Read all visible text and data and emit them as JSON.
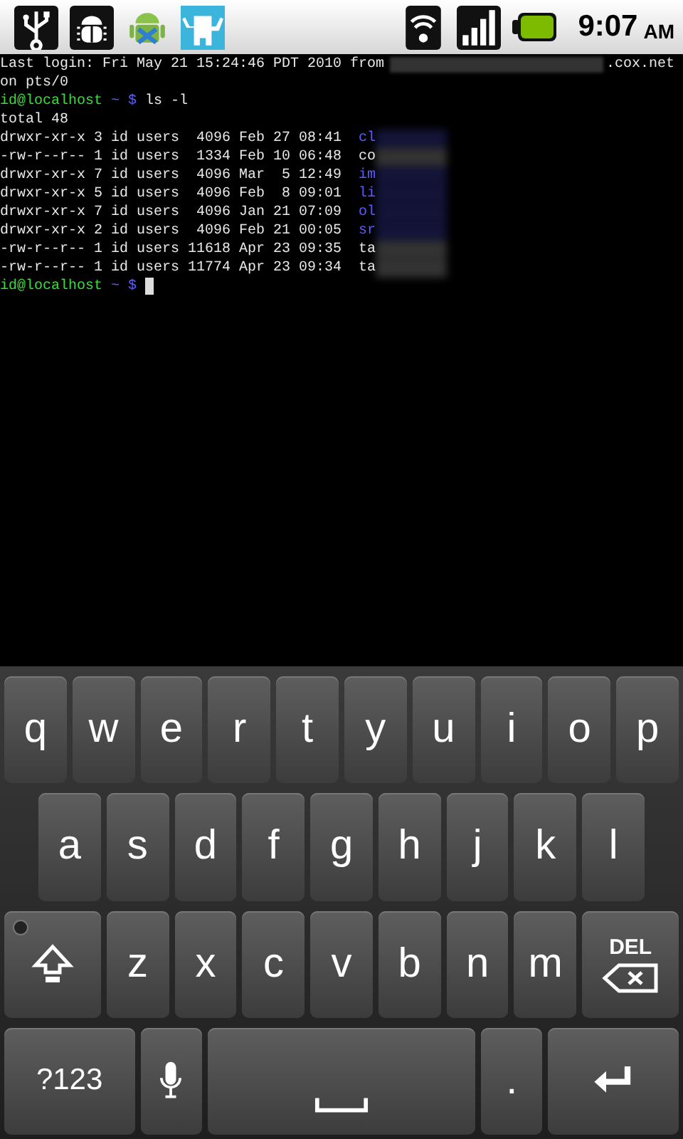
{
  "status_bar": {
    "time": "9:07",
    "meridiem": "AM"
  },
  "terminal": {
    "lines": [
      {
        "kind": "login",
        "before": "Last login: Fri May 21 15:24:46 PDT 2010 from",
        "after": ".cox.net"
      },
      {
        "kind": "plain",
        "text": "on pts/0"
      },
      {
        "kind": "prompt",
        "host": "id@localhost",
        "dir": "~",
        "symbol": "$",
        "command": "ls -l",
        "cursor": false
      },
      {
        "kind": "plain",
        "text": "total 48"
      },
      {
        "kind": "entry",
        "text": "drwxr-xr-x 3 id users  4096 Feb 27 08:41",
        "name": "cl",
        "color": "#5c5cff"
      },
      {
        "kind": "entry",
        "text": "-rw-r--r-- 1 id users  1334 Feb 10 06:48",
        "name": "co",
        "color": "#e8e8e8"
      },
      {
        "kind": "entry",
        "text": "drwxr-xr-x 7 id users  4096 Mar  5 12:49",
        "name": "im",
        "color": "#5c5cff"
      },
      {
        "kind": "entry",
        "text": "drwxr-xr-x 5 id users  4096 Feb  8 09:01",
        "name": "li",
        "color": "#5c5cff"
      },
      {
        "kind": "entry",
        "text": "drwxr-xr-x 7 id users  4096 Jan 21 07:09",
        "name": "ol",
        "color": "#5c5cff"
      },
      {
        "kind": "entry",
        "text": "drwxr-xr-x 2 id users  4096 Feb 21 00:05",
        "name": "sr",
        "color": "#5c5cff"
      },
      {
        "kind": "entry",
        "text": "-rw-r--r-- 1 id users 11618 Apr 23 09:35",
        "name": "ta",
        "color": "#e8e8e8"
      },
      {
        "kind": "entry",
        "text": "-rw-r--r-- 1 id users 11774 Apr 23 09:34",
        "name": "ta",
        "color": "#e8e8e8"
      },
      {
        "kind": "prompt",
        "host": "id@localhost",
        "dir": "~",
        "symbol": "$",
        "cursor": true
      }
    ]
  },
  "keyboard": {
    "caps_lock": false,
    "rows": [
      [
        {
          "kind": "char",
          "label": "q"
        },
        {
          "kind": "char",
          "label": "w"
        },
        {
          "kind": "char",
          "label": "e"
        },
        {
          "kind": "char",
          "label": "r"
        },
        {
          "kind": "char",
          "label": "t"
        },
        {
          "kind": "char",
          "label": "y"
        },
        {
          "kind": "char",
          "label": "u"
        },
        {
          "kind": "char",
          "label": "i"
        },
        {
          "kind": "char",
          "label": "o"
        },
        {
          "kind": "char",
          "label": "p"
        }
      ],
      [
        {
          "kind": "char",
          "label": "a"
        },
        {
          "kind": "char",
          "label": "s"
        },
        {
          "kind": "char",
          "label": "d"
        },
        {
          "kind": "char",
          "label": "f"
        },
        {
          "kind": "char",
          "label": "g"
        },
        {
          "kind": "char",
          "label": "h"
        },
        {
          "kind": "char",
          "label": "j"
        },
        {
          "kind": "char",
          "label": "k"
        },
        {
          "kind": "char",
          "label": "l"
        }
      ],
      [
        {
          "kind": "shift"
        },
        {
          "kind": "char",
          "label": "z"
        },
        {
          "kind": "char",
          "label": "x"
        },
        {
          "kind": "char",
          "label": "c"
        },
        {
          "kind": "char",
          "label": "v"
        },
        {
          "kind": "char",
          "label": "b"
        },
        {
          "kind": "char",
          "label": "n"
        },
        {
          "kind": "char",
          "label": "m"
        },
        {
          "kind": "delete",
          "label": "DEL"
        }
      ],
      [
        {
          "kind": "symbols",
          "label": "?123"
        },
        {
          "kind": "mic"
        },
        {
          "kind": "space"
        },
        {
          "kind": "char",
          "label": "."
        },
        {
          "kind": "enter"
        }
      ]
    ]
  }
}
